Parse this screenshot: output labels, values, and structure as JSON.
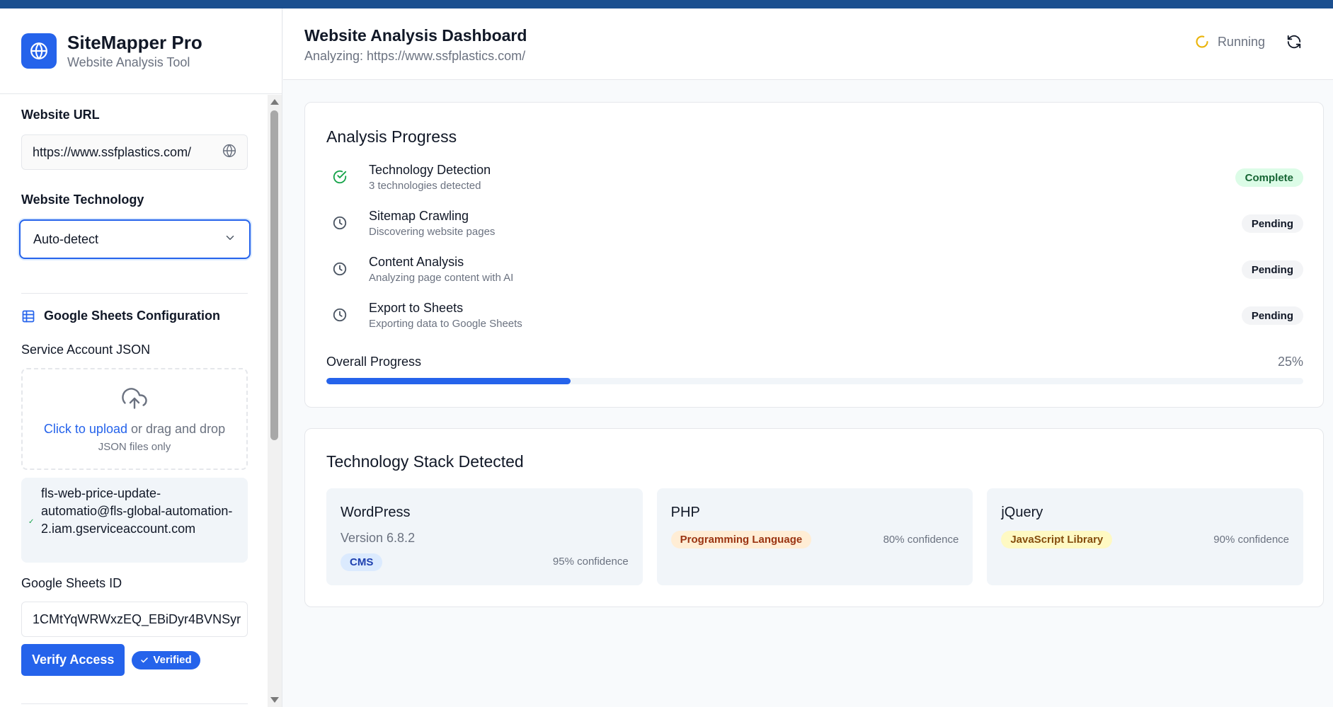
{
  "app": {
    "name": "SiteMapper Pro",
    "tagline": "Website Analysis Tool"
  },
  "colors": {
    "accent": "#2563eb",
    "topbar": "#1b4f8f",
    "success": "#16a34a",
    "running": "#eab308"
  },
  "sidebar": {
    "url_label": "Website URL",
    "url_value": "https://www.ssfplastics.com/",
    "tech_label": "Website Technology",
    "tech_selected": "Auto-detect",
    "sheets_heading": "Google Sheets Configuration",
    "service_account_label": "Service Account JSON",
    "upload_link": "Click to upload",
    "upload_rest": " or drag and drop",
    "upload_hint": "JSON files only",
    "service_account_email": "fls-web-price-update-automatio@fls-global-automation-2.iam.gserviceaccount.com",
    "sheets_id_label": "Google Sheets ID",
    "sheets_id_value": "1CMtYqWRWxzEQ_EBiDyr4BVNSyr",
    "verify_button": "Verify Access",
    "verified_badge": "Verified"
  },
  "header": {
    "title": "Website Analysis Dashboard",
    "subtitle": "Analyzing: https://www.ssfplastics.com/",
    "status": "Running"
  },
  "progress": {
    "title": "Analysis Progress",
    "steps": [
      {
        "title": "Technology Detection",
        "desc": "3 technologies detected",
        "status": "Complete",
        "icon": "check-circle-icon"
      },
      {
        "title": "Sitemap Crawling",
        "desc": "Discovering website pages",
        "status": "Pending",
        "icon": "clock-icon"
      },
      {
        "title": "Content Analysis",
        "desc": "Analyzing page content with AI",
        "status": "Pending",
        "icon": "clock-icon"
      },
      {
        "title": "Export to Sheets",
        "desc": "Exporting data to Google Sheets",
        "status": "Pending",
        "icon": "clock-icon"
      }
    ],
    "overall_label": "Overall Progress",
    "overall_percent_text": "25%",
    "overall_fraction": 0.25
  },
  "tech_stack": {
    "title": "Technology Stack Detected",
    "items": [
      {
        "name": "WordPress",
        "version": "Version 6.8.2",
        "tag": "CMS",
        "confidence": "95% confidence"
      },
      {
        "name": "PHP",
        "tag": "Programming Language",
        "confidence": "80% confidence"
      },
      {
        "name": "jQuery",
        "tag": "JavaScript Library",
        "confidence": "90% confidence"
      }
    ]
  }
}
